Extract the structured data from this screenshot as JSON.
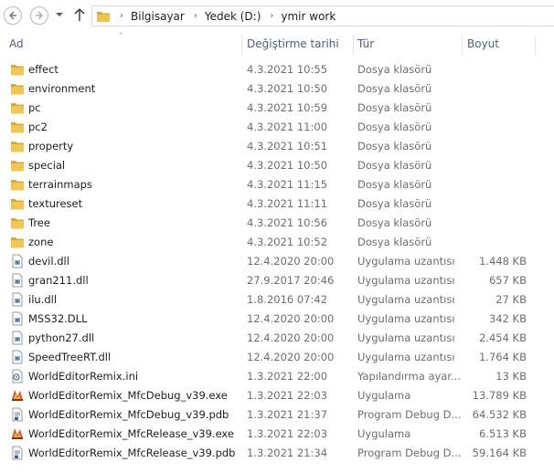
{
  "breadcrumb": {
    "items": [
      "Bilgisayar",
      "Yedek (D:)",
      "ymir work"
    ]
  },
  "columns": {
    "name": "Ad",
    "date": "Değiştirme tarihi",
    "type": "Tür",
    "size": "Boyut"
  },
  "files": [
    {
      "name": "effect",
      "date": "4.3.2021 10:55",
      "type": "Dosya klasörü",
      "size": "",
      "icon": "folder-icon"
    },
    {
      "name": "environment",
      "date": "4.3.2021 10:50",
      "type": "Dosya klasörü",
      "size": "",
      "icon": "folder-icon"
    },
    {
      "name": "pc",
      "date": "4.3.2021 10:59",
      "type": "Dosya klasörü",
      "size": "",
      "icon": "folder-icon"
    },
    {
      "name": "pc2",
      "date": "4.3.2021 11:00",
      "type": "Dosya klasörü",
      "size": "",
      "icon": "folder-icon"
    },
    {
      "name": "property",
      "date": "4.3.2021 10:51",
      "type": "Dosya klasörü",
      "size": "",
      "icon": "folder-icon"
    },
    {
      "name": "special",
      "date": "4.3.2021 10:50",
      "type": "Dosya klasörü",
      "size": "",
      "icon": "folder-icon"
    },
    {
      "name": "terrainmaps",
      "date": "4.3.2021 11:15",
      "type": "Dosya klasörü",
      "size": "",
      "icon": "folder-icon"
    },
    {
      "name": "textureset",
      "date": "4.3.2021 11:11",
      "type": "Dosya klasörü",
      "size": "",
      "icon": "folder-icon"
    },
    {
      "name": "Tree",
      "date": "4.3.2021 10:56",
      "type": "Dosya klasörü",
      "size": "",
      "icon": "folder-icon"
    },
    {
      "name": "zone",
      "date": "4.3.2021 10:52",
      "type": "Dosya klasörü",
      "size": "",
      "icon": "folder-icon"
    },
    {
      "name": "devil.dll",
      "date": "12.4.2020 20:00",
      "type": "Uygulama uzantısı",
      "size": "1.448 KB",
      "icon": "dll-icon"
    },
    {
      "name": "gran211.dll",
      "date": "27.9.2017 20:46",
      "type": "Uygulama uzantısı",
      "size": "657 KB",
      "icon": "dll-icon"
    },
    {
      "name": "ilu.dll",
      "date": "1.8.2016 07:42",
      "type": "Uygulama uzantısı",
      "size": "27 KB",
      "icon": "dll-icon"
    },
    {
      "name": "MSS32.DLL",
      "date": "12.4.2020 20:00",
      "type": "Uygulama uzantısı",
      "size": "342 KB",
      "icon": "dll-icon"
    },
    {
      "name": "python27.dll",
      "date": "12.4.2020 20:00",
      "type": "Uygulama uzantısı",
      "size": "2.454 KB",
      "icon": "dll-icon"
    },
    {
      "name": "SpeedTreeRT.dll",
      "date": "12.4.2020 20:00",
      "type": "Uygulama uzantısı",
      "size": "1.764 KB",
      "icon": "dll-icon"
    },
    {
      "name": "WorldEditorRemix.ini",
      "date": "1.3.2021 22:00",
      "type": "Yapılandırma ayar...",
      "size": "13 KB",
      "icon": "ini-icon"
    },
    {
      "name": "WorldEditorRemix_MfcDebug_v39.exe",
      "date": "1.3.2021 22:03",
      "type": "Uygulama",
      "size": "13.789 KB",
      "icon": "exe-icon"
    },
    {
      "name": "WorldEditorRemix_MfcDebug_v39.pdb",
      "date": "1.3.2021 21:37",
      "type": "Program Debug D...",
      "size": "64.532 KB",
      "icon": "pdb-icon"
    },
    {
      "name": "WorldEditorRemix_MfcRelease_v39.exe",
      "date": "1.3.2021 22:03",
      "type": "Uygulama",
      "size": "6.513 KB",
      "icon": "exe-icon"
    },
    {
      "name": "WorldEditorRemix_MfcRelease_v39.pdb",
      "date": "1.3.2021 21:34",
      "type": "Program Debug D...",
      "size": "59.164 KB",
      "icon": "pdb-icon"
    }
  ],
  "colors": {
    "folder": "#e8b43c",
    "header_text": "#4c607a",
    "secondary_text": "#6d6d6d"
  }
}
